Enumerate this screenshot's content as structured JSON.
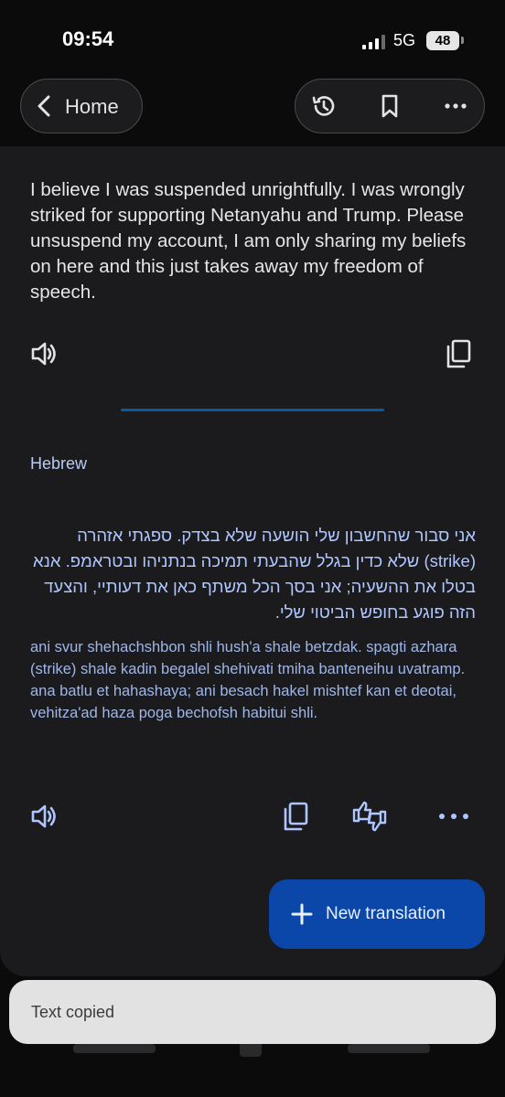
{
  "status_bar": {
    "time": "09:54",
    "network": "5G",
    "battery": "48"
  },
  "header": {
    "home_label": "Home"
  },
  "source": {
    "text": "I believe I was suspended unrightfully. I was wrongly striked for supporting Netanyahu and Trump. Please unsuspend my account, I am only sharing my beliefs on here and this just takes away my freedom of speech."
  },
  "translation": {
    "language": "Hebrew",
    "text": "אני סבור שהחשבון שלי הושעה שלא בצדק. ספגתי אזהרה (strike) שלא כדין בגלל שהבעתי תמיכה בנתניהו ובטראמפ. אנא בטלו את ההשעיה; אני בסך הכל משתף כאן את דעותיי, והצעד הזה פוגע בחופש הביטוי שלי.",
    "transliteration": "ani svur shehachshbon shli hush'a shale betzdak. spagti azhara (strike) shale kadin begalel shehivati tmiha banteneihu uvatramp. ana batlu et hahashaya; ani besach hakel mishtef kan et deotai, vehitza'ad haza poga bechofsh habitui shli."
  },
  "fab": {
    "label": "New translation"
  },
  "toast": {
    "text": "Text copied"
  },
  "colors": {
    "accent": "#0a47a8",
    "translation_text": "#aec6ff",
    "divider": "#0b5a9e"
  }
}
